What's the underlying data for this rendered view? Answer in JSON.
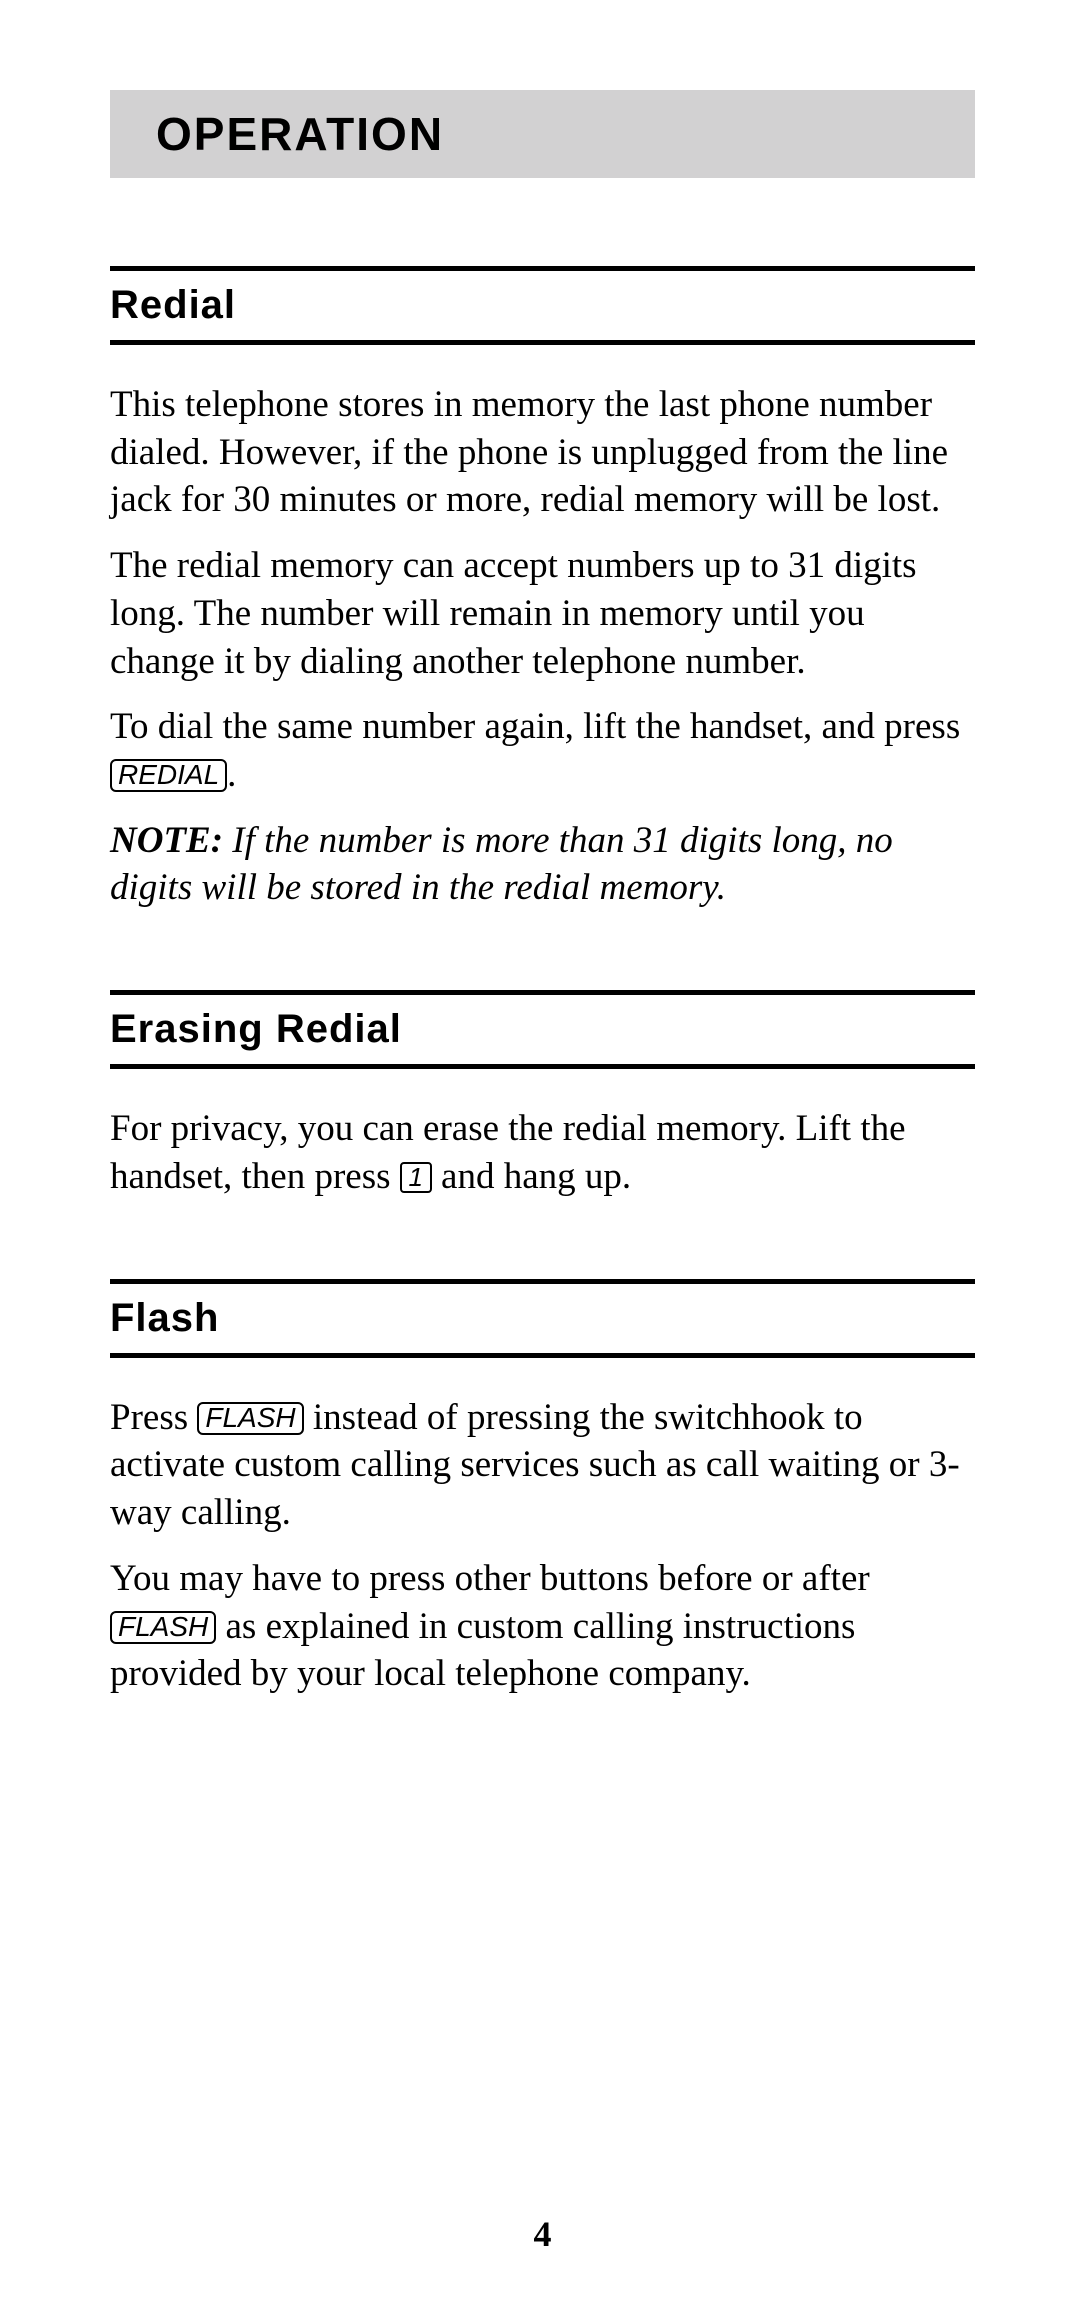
{
  "header": {
    "title": "OPERATION"
  },
  "sections": {
    "redial": {
      "heading": "Redial",
      "p1": "This telephone stores in memory the last phone number dialed.  However, if the phone is unplugged from the line jack for 30 minutes or more, redial memory will be lost.",
      "p2": "The redial memory can accept numbers up to 31 digits long. The number will remain in memory until you change it by dialing another telephone number.",
      "p3a": "To dial the same number again, lift the handset, and press ",
      "p3_key": "REDIAL",
      "p3b": ".",
      "note_label": "NOTE:",
      "note_body": " If the number is more than 31 digits long, no digits will be stored in the redial memory."
    },
    "erasing": {
      "heading": "Erasing Redial",
      "p1a": "For privacy, you can erase the redial memory. Lift the handset, then press ",
      "p1_key": "1",
      "p1b": " and hang up."
    },
    "flash": {
      "heading": "Flash",
      "p1a": "Press ",
      "p1_key": "FLASH",
      "p1b": " instead of pressing the switchhook to activate custom calling services such as call waiting or 3-way calling.",
      "p2a": "You may have to press other buttons before or after ",
      "p2_key": "FLASH",
      "p2b": " as explained in custom calling instructions provided by your local telephone company."
    }
  },
  "page_number": "4"
}
